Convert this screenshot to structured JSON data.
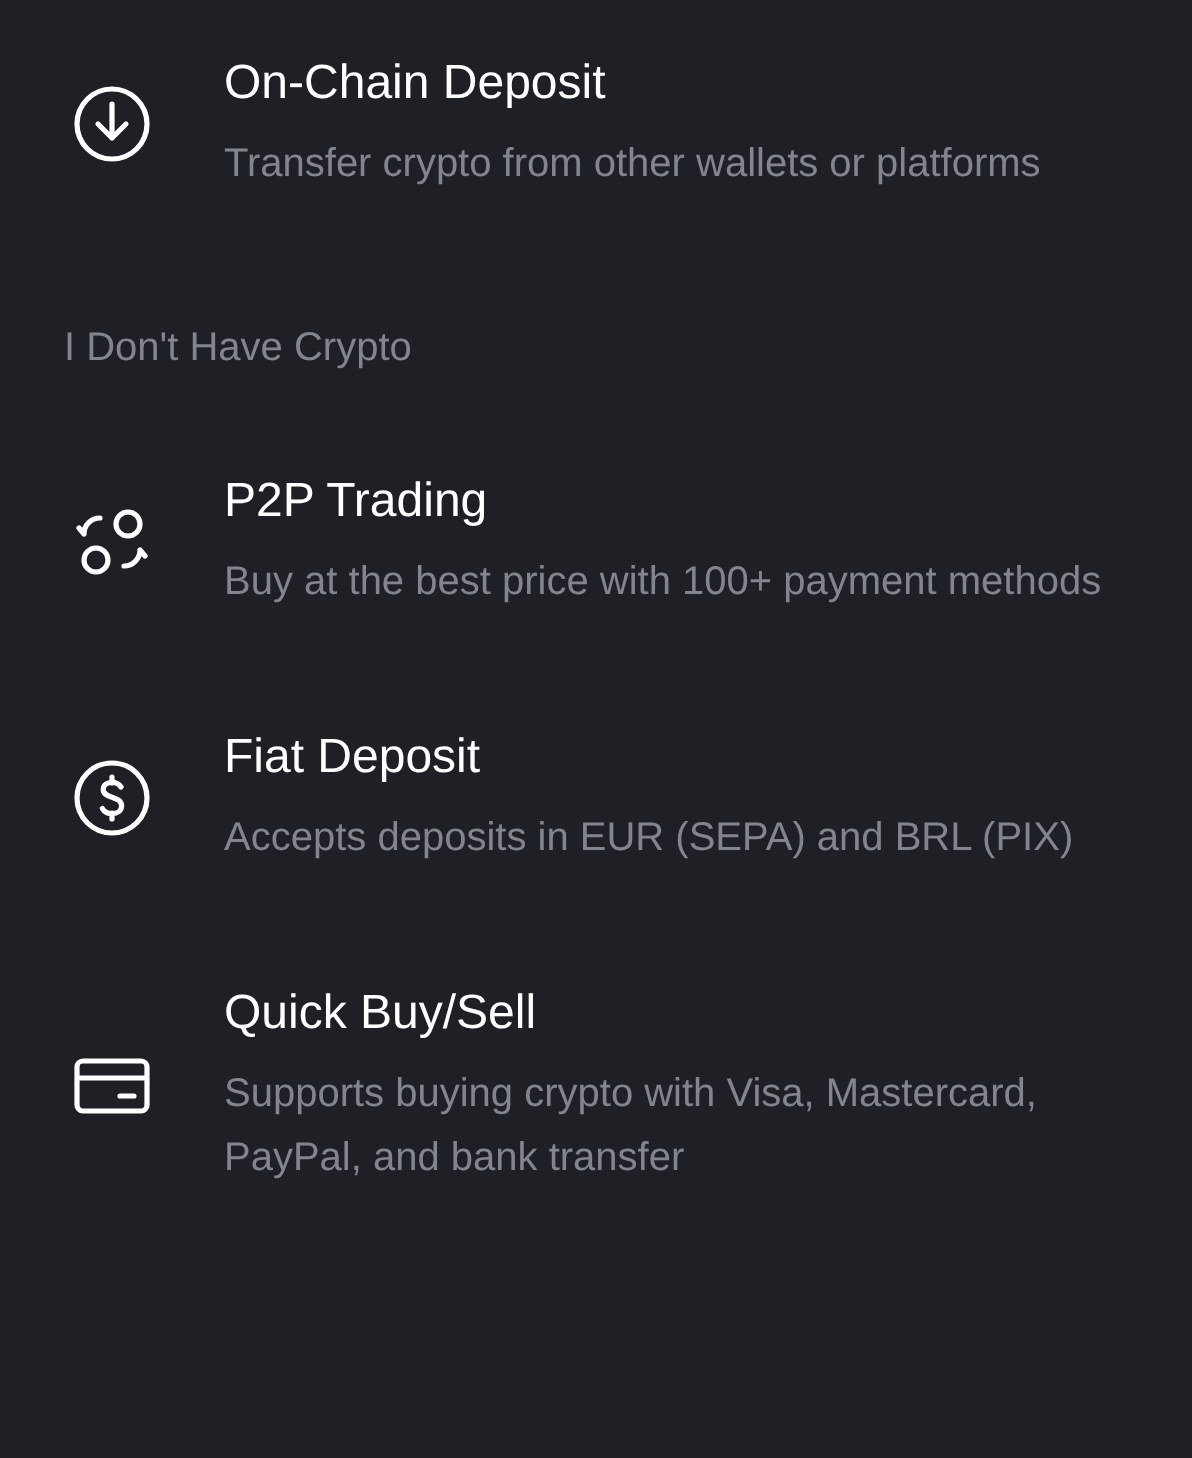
{
  "sections": [
    {
      "items": [
        {
          "title": "On-Chain Deposit",
          "description": "Transfer crypto from other wallets or platforms"
        }
      ]
    },
    {
      "header": "I Don't Have Crypto",
      "items": [
        {
          "title": "P2P Trading",
          "description": "Buy at the best price with 100+ payment methods"
        },
        {
          "title": "Fiat Deposit",
          "description": "Accepts deposits in EUR (SEPA) and BRL (PIX)"
        },
        {
          "title": "Quick Buy/Sell",
          "description": "Supports buying crypto with Visa, Mastercard, PayPal, and bank transfer"
        }
      ]
    }
  ]
}
